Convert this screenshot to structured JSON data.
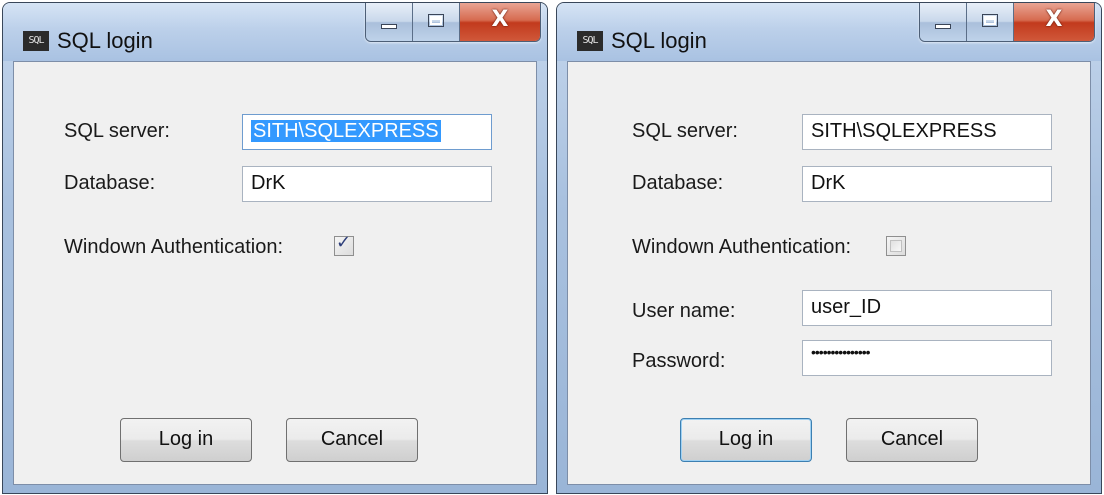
{
  "dialog_title": "SQL login",
  "app_icon_text": "SQL",
  "icons": {
    "app": "sql-app-icon",
    "minimize": "minimize-icon",
    "maximize": "maximize-icon",
    "close": "close-icon"
  },
  "caption": {
    "close_glyph": "X"
  },
  "labels": {
    "server": "SQL server:",
    "database": "Database:",
    "auth": "Windown Authentication:",
    "username": "User name:",
    "password": "Password:"
  },
  "buttons": {
    "login": "Log in",
    "cancel": "Cancel"
  },
  "left_dialog": {
    "server_value": "SITH\\SQLEXPRESS",
    "server_selected": true,
    "database_value": "DrK",
    "windows_auth_checked": true
  },
  "right_dialog": {
    "server_value": "SITH\\SQLEXPRESS",
    "database_value": "DrK",
    "windows_auth_checked": false,
    "username_value": "user_ID",
    "password_value": "•••••••••••••••"
  },
  "colors": {
    "selection": "#3399ff",
    "close_button": "#c23a1d",
    "default_button_border": "#3c7fb1"
  }
}
